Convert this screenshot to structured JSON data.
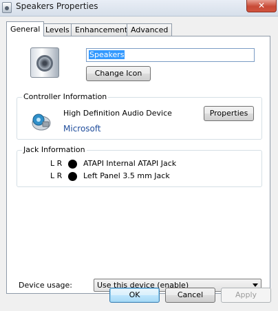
{
  "window": {
    "title": "Speakers Properties",
    "close_label": "✕"
  },
  "tabs": [
    {
      "label": "General",
      "active": true
    },
    {
      "label": "Levels",
      "active": false
    },
    {
      "label": "Enhancements",
      "active": false
    },
    {
      "label": "Advanced",
      "active": false
    }
  ],
  "general": {
    "device_name": "Speakers",
    "change_icon_label": "Change Icon"
  },
  "controller": {
    "group_title": "Controller Information",
    "device": "High Definition Audio Device",
    "manufacturer": "Microsoft",
    "properties_label": "Properties"
  },
  "jack": {
    "group_title": "Jack Information",
    "rows": [
      {
        "channels": "L R",
        "name": "ATAPI Internal ATAPI Jack"
      },
      {
        "channels": "L R",
        "name": "Left Panel 3.5 mm Jack"
      }
    ]
  },
  "device_usage": {
    "label": "Device usage:",
    "selected": "Use this device (enable)"
  },
  "buttons": {
    "ok": "OK",
    "cancel": "Cancel",
    "apply": "Apply"
  },
  "colors": {
    "accent": "#3399ff",
    "link": "#1f4c9b",
    "close": "#c84a36"
  }
}
